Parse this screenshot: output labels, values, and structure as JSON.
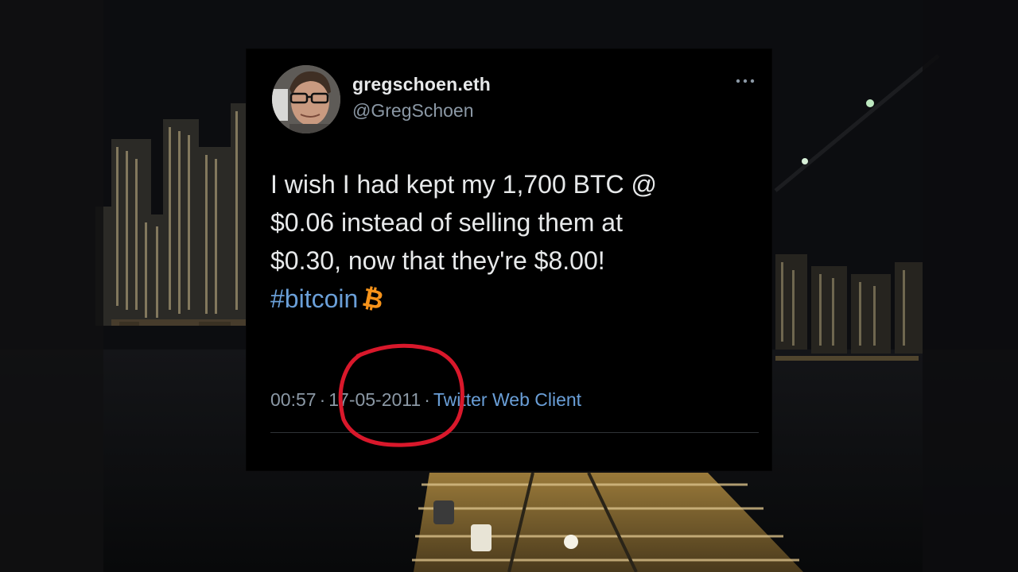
{
  "tweet": {
    "display_name": "gregschoen.eth",
    "handle": "@GregSchoen",
    "more_icon": "more-horizontal-icon",
    "text_line_1": "I wish I had kept my 1,700 BTC @",
    "text_line_2": "$0.06 instead of selling them at",
    "text_line_3": "$0.30, now that they're $8.00!",
    "hashtag": "#bitcoin",
    "emoji": "₿",
    "time": "00:57",
    "date": "17-05-2011",
    "separator": "·",
    "client": "Twitter Web Client"
  },
  "annotation": {
    "type": "hand-drawn-circle",
    "color": "#d9182b",
    "target": "date"
  },
  "colors": {
    "card_background": "#000000",
    "text": "#e7e9ea",
    "muted": "#8b98a5",
    "link": "#6a9fd8",
    "bitcoin": "#f7931a"
  }
}
